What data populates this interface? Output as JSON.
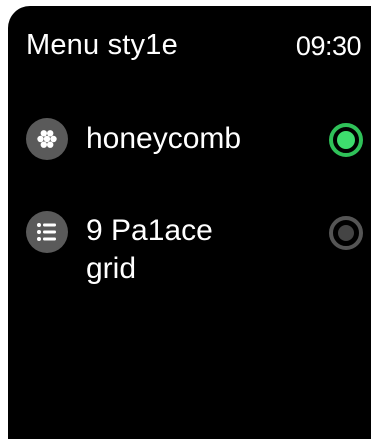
{
  "header": {
    "title": "Menu sty1e",
    "time": "09:30"
  },
  "options": [
    {
      "label": "honeycomb",
      "icon": "honeycomb-icon",
      "selected": true
    },
    {
      "label": "9 Pa1ace grid",
      "icon": "list-icon",
      "selected": false
    }
  ],
  "colors": {
    "screen_background": "#000000",
    "text": "#ffffff",
    "icon_background": "#5a5a5a",
    "radio_selected": "#3edc6e",
    "radio_unselected": "#555555"
  }
}
